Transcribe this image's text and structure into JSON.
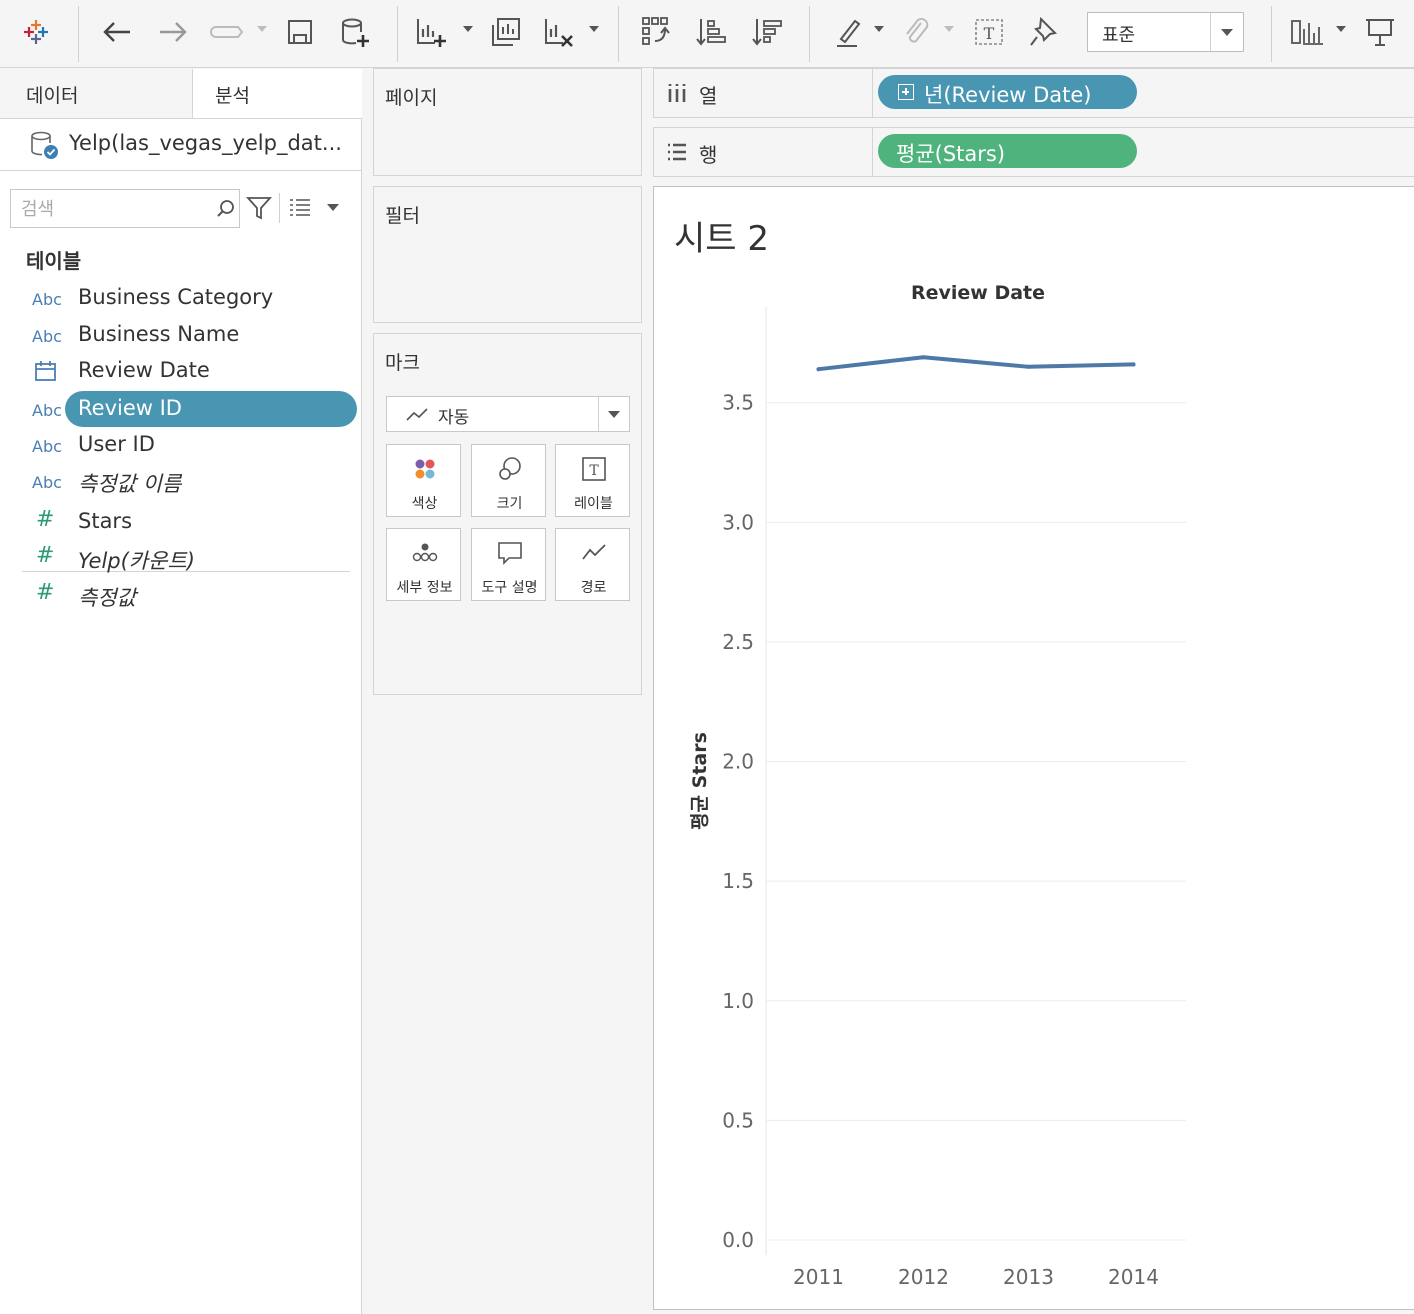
{
  "toolbar": {
    "format_select": "표준",
    "icons": [
      "tableau-logo-icon",
      "undo-icon",
      "redo-icon",
      "replay-icon",
      "save-icon",
      "new-datasource-icon",
      "new-worksheet-icon",
      "duplicate-sheet-icon",
      "clear-sheet-icon",
      "swap-rows-columns-icon",
      "sort-ascending-icon",
      "sort-descending-icon",
      "highlight-icon",
      "group-icon",
      "show-labels-icon",
      "pin-icon",
      "fit-icon",
      "presentation-icon"
    ]
  },
  "left_pane": {
    "tabs": {
      "data": "데이터",
      "analysis": "분석"
    },
    "datasource": "Yelp(las_vegas_yelp_dat...",
    "search": {
      "placeholder": "검색"
    },
    "tables_heading": "테이블",
    "dimensions": [
      {
        "type": "Abc",
        "name": "Business Category"
      },
      {
        "type": "Abc",
        "name": "Business Name"
      },
      {
        "type": "date",
        "name": "Review Date"
      },
      {
        "type": "Abc",
        "name": "Review ID",
        "selected": true
      },
      {
        "type": "Abc",
        "name": "User ID"
      },
      {
        "type": "Abc",
        "name": "측정값 이름",
        "italic": true
      }
    ],
    "measures": [
      {
        "type": "#",
        "name": "Stars"
      },
      {
        "type": "#",
        "name": "Yelp(카운트)",
        "italic": true
      },
      {
        "type": "#",
        "name": "측정값",
        "italic": true
      }
    ]
  },
  "cards": {
    "pages": "페이지",
    "filters": "필터",
    "marks": {
      "title": "마크",
      "type": "자동",
      "buttons": [
        "색상",
        "크기",
        "레이블",
        "세부 정보",
        "도구 설명",
        "경로"
      ]
    }
  },
  "shelves": {
    "columns": {
      "label": "열",
      "pill": "년(Review Date)"
    },
    "rows": {
      "label": "행",
      "pill": "평균(Stars)"
    }
  },
  "sheet": {
    "title": "시트 2"
  },
  "chart_data": {
    "type": "line",
    "title": "",
    "xlabel": "Review Date",
    "ylabel": "평균 Stars",
    "categories": [
      "2011",
      "2012",
      "2013",
      "2014"
    ],
    "series": [
      {
        "values": [
          3.64,
          3.69,
          3.65,
          3.66
        ]
      }
    ],
    "ylim": [
      0,
      3.9
    ],
    "yticks": [
      "0.0",
      "0.5",
      "1.0",
      "1.5",
      "2.0",
      "2.5",
      "3.0",
      "3.5"
    ],
    "grid": true,
    "line_color": "#4e79a7"
  }
}
